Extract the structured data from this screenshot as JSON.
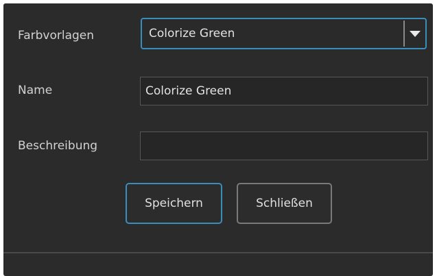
{
  "form": {
    "preset_label": "Farbvorlagen",
    "preset_selected": "Colorize Green",
    "name_label": "Name",
    "name_value": "Colorize Green",
    "description_label": "Beschreibung",
    "description_value": ""
  },
  "buttons": {
    "save_label": "Speichern",
    "close_label": "Schließen"
  },
  "icons": {
    "dropdown": "chevron-down-icon"
  },
  "colors": {
    "background": "#2b2b2b",
    "focus_accent": "#3a8dbd",
    "text": "#d2d2d2"
  }
}
